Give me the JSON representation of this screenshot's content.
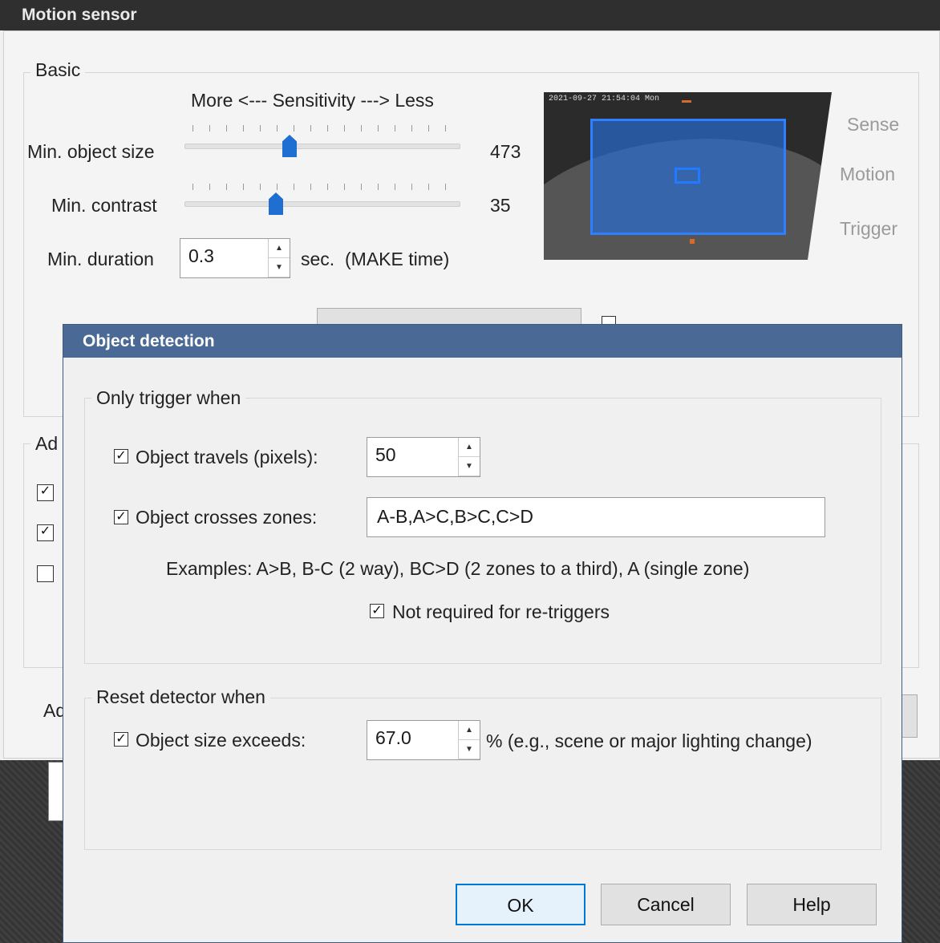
{
  "motion_sensor": {
    "title": "Motion sensor",
    "basic_group_label": "Basic",
    "sensitivity_label": "More <--- Sensitivity ---> Less",
    "min_object_size": {
      "label": "Min. object size",
      "value": "473"
    },
    "min_contrast": {
      "label": "Min. contrast",
      "value": "35"
    },
    "min_duration": {
      "label": "Min. duration",
      "value": "0.3",
      "unit": "sec.",
      "note": "(MAKE time)"
    },
    "preview_timestamp": "2021-09-27 21:54:04 Mon",
    "side_labels": [
      "Sense",
      "Motion",
      "Trigger"
    ],
    "advanced_group_label_partial": "Ad",
    "bottom_label_partial": "Ad"
  },
  "object_detection": {
    "title": "Object detection",
    "only_trigger_when": {
      "label": "Only trigger when",
      "object_travels": {
        "label": "Object travels (pixels):",
        "checked": true,
        "value": "50"
      },
      "object_crosses": {
        "label": "Object crosses zones:",
        "checked": true,
        "value": "A-B,A>C,B>C,C>D"
      },
      "examples": "Examples:  A>B, B-C (2 way), BC>D (2 zones to a third), A (single zone)",
      "not_required": {
        "label": "Not required for re-triggers",
        "checked": true
      }
    },
    "reset_detector_when": {
      "label": "Reset detector when",
      "object_size_exceeds": {
        "label": "Object size exceeds:",
        "checked": true,
        "value": "67.0",
        "suffix": "% (e.g., scene or major lighting change)"
      }
    },
    "buttons": {
      "ok": "OK",
      "cancel": "Cancel",
      "help": "Help"
    }
  },
  "colors": {
    "accent": "#1e6fd1",
    "dialog_title": "#4a6a95",
    "window_title": "#2f2f2f"
  }
}
